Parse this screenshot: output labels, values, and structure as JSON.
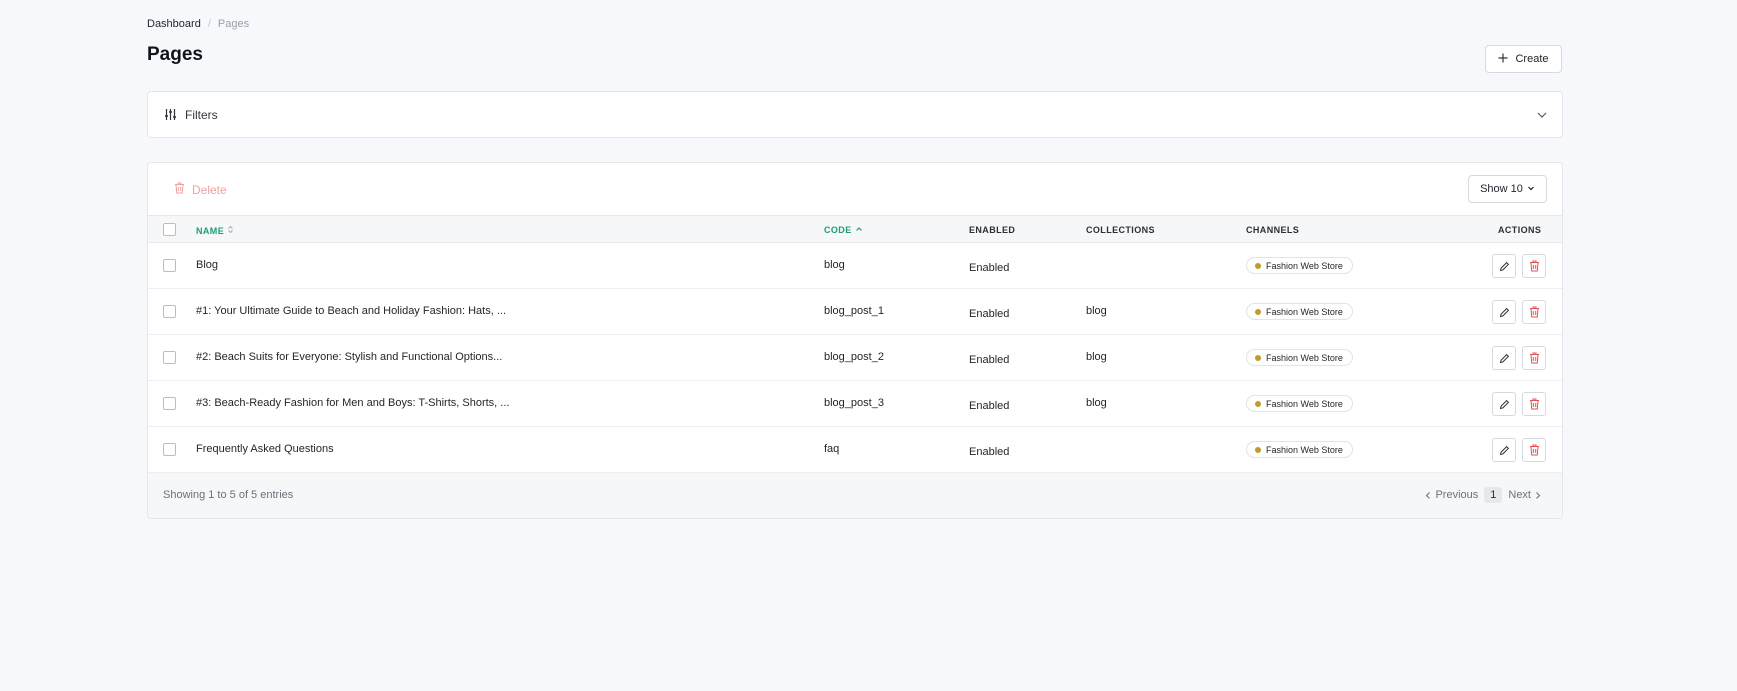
{
  "breadcrumb": {
    "root": "Dashboard",
    "current": "Pages"
  },
  "page": {
    "title": "Pages"
  },
  "toolbar": {
    "create_label": "Create",
    "delete_label": "Delete",
    "show_label": "Show 10"
  },
  "filters": {
    "label": "Filters"
  },
  "table": {
    "columns": {
      "name": "NAME",
      "code": "CODE",
      "enabled": "ENABLED",
      "collections": "COLLECTIONS",
      "channels": "CHANNELS",
      "actions": "ACTIONS"
    },
    "rows": [
      {
        "name": "Blog",
        "code": "blog",
        "enabled": "Enabled",
        "collections": "",
        "channel": "Fashion Web Store"
      },
      {
        "name": "#1: Your Ultimate Guide to Beach and Holiday Fashion: Hats, ...",
        "code": "blog_post_1",
        "enabled": "Enabled",
        "collections": "blog",
        "channel": "Fashion Web Store"
      },
      {
        "name": "#2: Beach Suits for Everyone: Stylish and Functional Options...",
        "code": "blog_post_2",
        "enabled": "Enabled",
        "collections": "blog",
        "channel": "Fashion Web Store"
      },
      {
        "name": "#3: Beach-Ready Fashion for Men and Boys: T-Shirts, Shorts, ...",
        "code": "blog_post_3",
        "enabled": "Enabled",
        "collections": "blog",
        "channel": "Fashion Web Store"
      },
      {
        "name": "Frequently Asked Questions",
        "code": "faq",
        "enabled": "Enabled",
        "collections": "",
        "channel": "Fashion Web Store"
      }
    ]
  },
  "pagination": {
    "summary": "Showing 1 to 5 of 5 entries",
    "previous": "Previous",
    "current_page": "1",
    "next": "Next"
  },
  "colors": {
    "accent": "#1f9d74",
    "danger": "#e05252",
    "channel_dot": "#c29a2e"
  }
}
